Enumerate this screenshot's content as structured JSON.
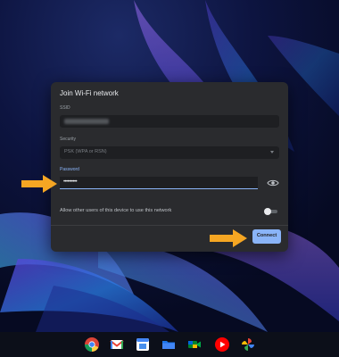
{
  "dialog": {
    "title": "Join Wi-Fi network",
    "ssid": {
      "label": "SSID",
      "value": ""
    },
    "security": {
      "label": "Security",
      "value": "PSK (WPA or RSN)"
    },
    "password": {
      "label": "Password",
      "value": "••••••••••"
    },
    "share": {
      "label": "Allow other users of this device to use this network",
      "enabled": false
    },
    "connect_label": "Connect"
  },
  "shelf": {
    "apps": [
      "chrome-icon",
      "gmail-icon",
      "calendar-icon",
      "files-icon",
      "meet-icon",
      "youtube-icon",
      "photos-icon"
    ]
  },
  "colors": {
    "accent": "#8ab4f8",
    "arrow": "#f5a623",
    "dialog_bg": "#2a2b2e"
  }
}
